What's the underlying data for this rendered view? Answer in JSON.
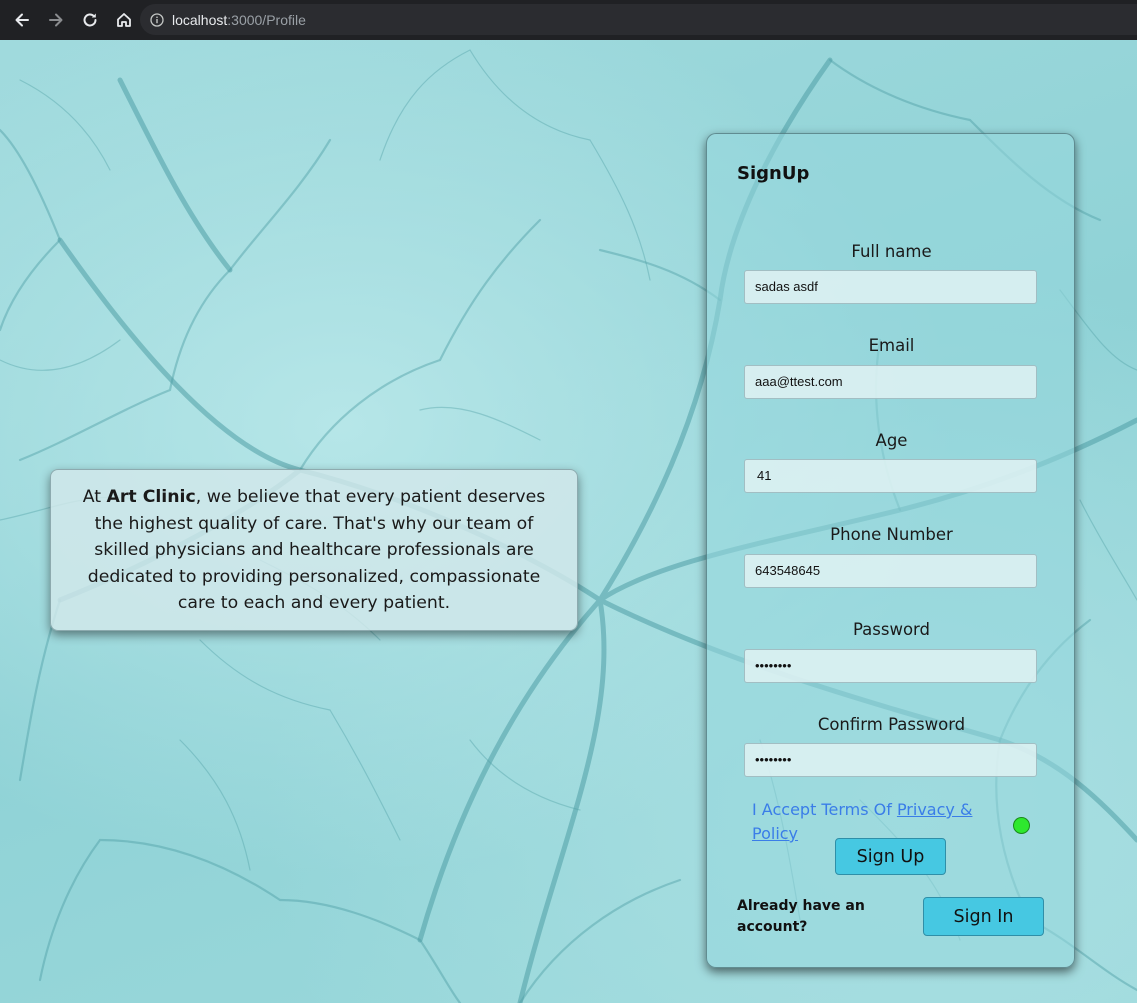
{
  "browser": {
    "url_host": "localhost",
    "url_rest": ":3000/Profile",
    "icons": [
      "back-arrow-icon",
      "forward-arrow-icon",
      "reload-icon",
      "home-icon",
      "info-icon"
    ]
  },
  "info_card": {
    "prefix": "At ",
    "brand": "Art Clinic",
    "body": ", we believe that every patient deserves the highest quality of care. That's why our team of skilled physicians and healthcare professionals are dedicated to providing personalized, compassionate care to each and every patient."
  },
  "signup": {
    "title": "SignUp",
    "fields": [
      {
        "label": "Full name",
        "value": "sadas asdf"
      },
      {
        "label": "Email",
        "value": "aaa@ttest.com"
      },
      {
        "label": "Age",
        "value": "41"
      },
      {
        "label": "Phone Number",
        "value": "643548645"
      },
      {
        "label": "Password",
        "value": "••••••••"
      },
      {
        "label": "Confirm Password",
        "value": "••••••••"
      }
    ],
    "terms_text": "I Accept Terms Of ",
    "terms_link": "Privacy & Policy",
    "signup_button": "Sign Up",
    "already_text": "Already have an account?",
    "signin_button": "Sign In"
  },
  "colors": {
    "browser_bar": "#202124",
    "accent_button": "#46c8e2",
    "link": "#3a7de8",
    "radio": "#2ee82e"
  }
}
